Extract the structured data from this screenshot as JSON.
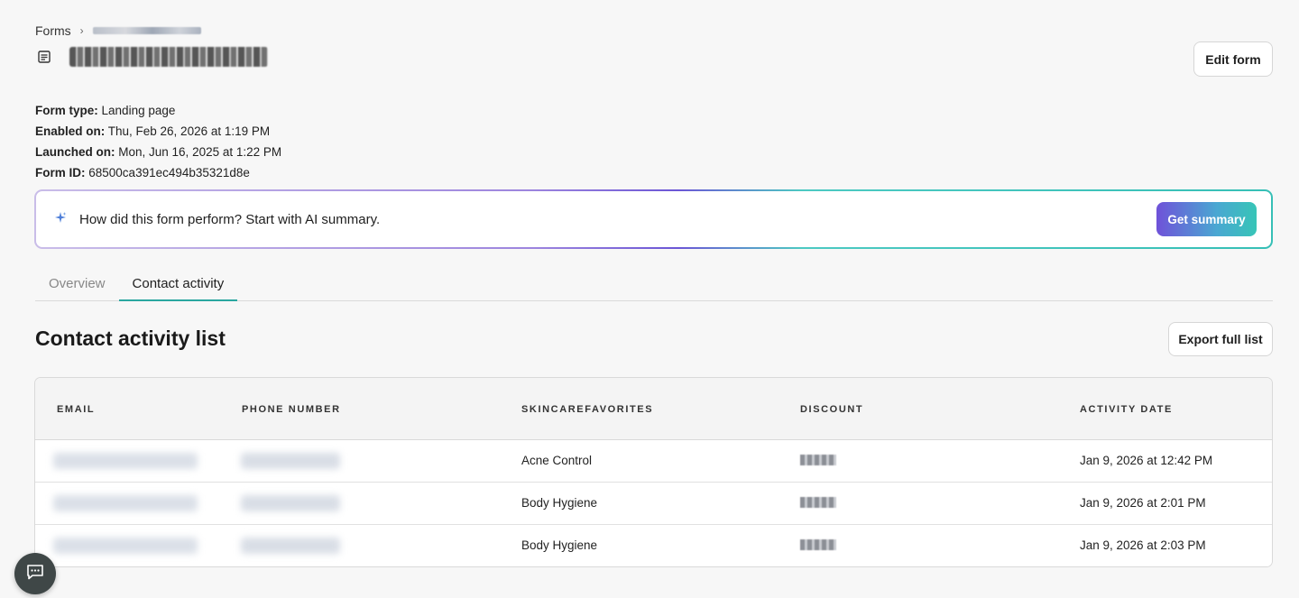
{
  "breadcrumb": {
    "root_label": "Forms",
    "separator": "›"
  },
  "header": {
    "edit_label": "Edit form"
  },
  "meta": {
    "form_type_label": "Form type:",
    "form_type_value": "Landing page",
    "enabled_label": "Enabled on:",
    "enabled_value": "Thu, Feb 26, 2026 at 1:19 PM",
    "launched_label": "Launched on:",
    "launched_value": "Mon, Jun 16, 2025 at 1:22 PM",
    "form_id_label": "Form ID:",
    "form_id_value": "68500ca391ec494b35321d8e"
  },
  "ai_banner": {
    "text": "How did this form perform? Start with AI summary.",
    "button_label": "Get summary",
    "icon": "sparkle-icon"
  },
  "tabs": [
    {
      "label": "Overview",
      "active": false
    },
    {
      "label": "Contact activity",
      "active": true
    }
  ],
  "section": {
    "title": "Contact activity list",
    "export_label": "Export full list"
  },
  "table": {
    "columns": [
      "EMAIL",
      "PHONE NUMBER",
      "SKINCAREFAVORITES",
      "DISCOUNT",
      "ACTIVITY DATE"
    ],
    "rows": [
      {
        "skincare": "Acne Control",
        "activity_date": "Jan 9, 2026 at 12:42 PM"
      },
      {
        "skincare": "Body Hygiene",
        "activity_date": "Jan 9, 2026 at 2:01 PM"
      },
      {
        "skincare": "Body Hygiene",
        "activity_date": "Jan 9, 2026 at 2:03 PM"
      }
    ]
  },
  "colors": {
    "accent_teal": "#2aa7a0",
    "summary_gradient_start": "#6f52d9",
    "summary_gradient_end": "#37c5b7",
    "chat_fab": "#3f4747"
  },
  "icons": {
    "form": "form-icon",
    "chat": "chat-icon",
    "chevron": "chevron-right-icon"
  }
}
